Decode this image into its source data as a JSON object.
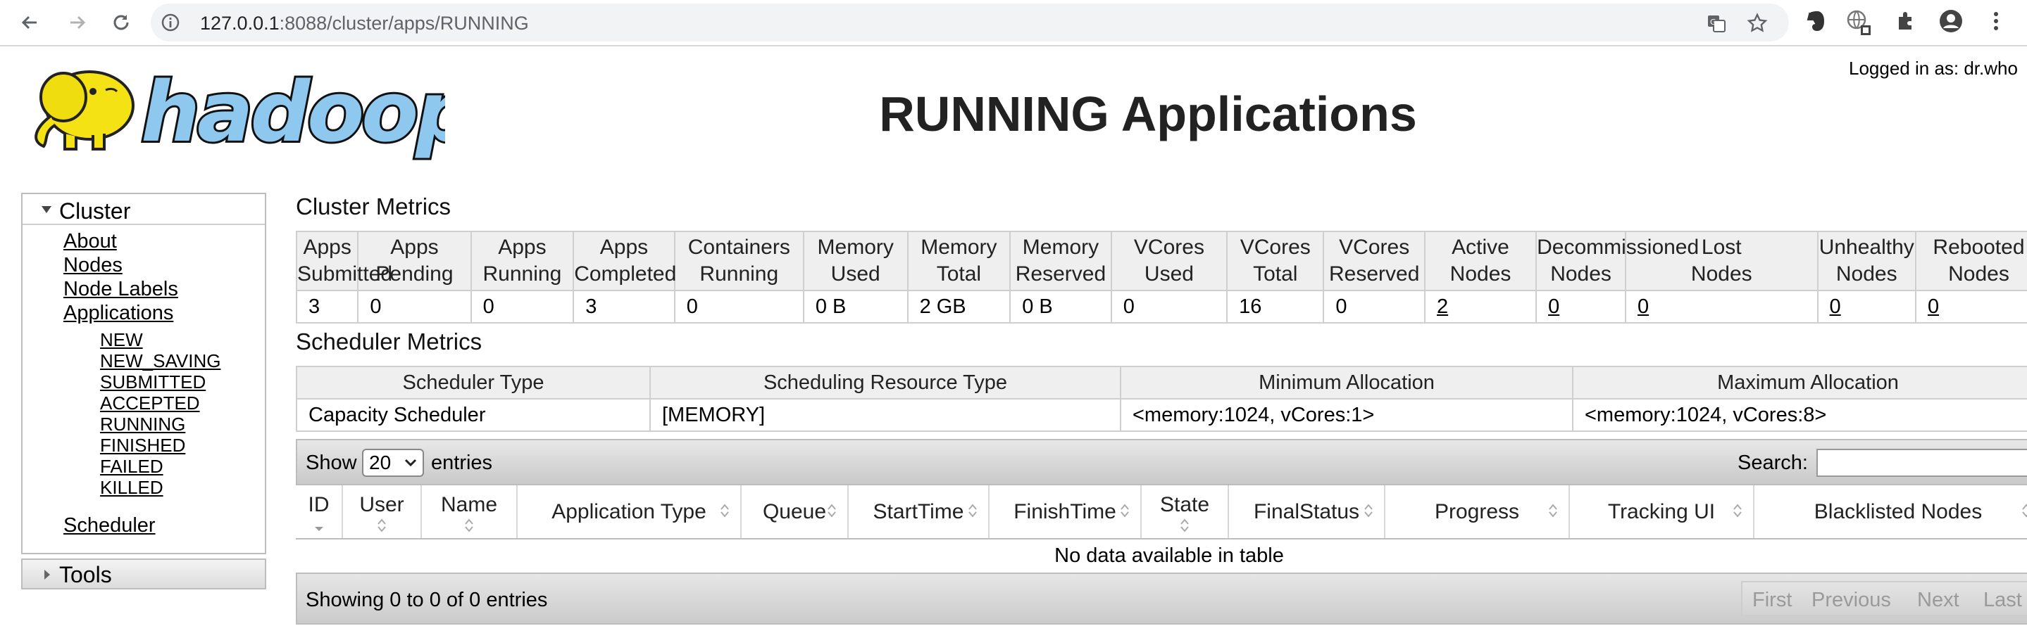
{
  "browser": {
    "url_host": "127.0.0.1",
    "url_path": ":8088/cluster/apps/RUNNING"
  },
  "header": {
    "logo_text": "hadoop",
    "title": "RUNNING Applications",
    "logged_in": "Logged in as: dr.who"
  },
  "sidebar": {
    "cluster_label": "Cluster",
    "links": [
      "About",
      "Nodes",
      "Node Labels",
      "Applications"
    ],
    "app_states": [
      "NEW",
      "NEW_SAVING",
      "SUBMITTED",
      "ACCEPTED",
      "RUNNING",
      "FINISHED",
      "FAILED",
      "KILLED"
    ],
    "scheduler_label": "Scheduler",
    "tools_label": "Tools"
  },
  "cluster_metrics": {
    "title": "Cluster Metrics",
    "headers": [
      [
        "Apps",
        "Submitted"
      ],
      [
        "Apps",
        "Pending"
      ],
      [
        "Apps",
        "Running"
      ],
      [
        "Apps",
        "Completed"
      ],
      [
        "Containers",
        "Running"
      ],
      [
        "Memory",
        "Used"
      ],
      [
        "Memory",
        "Total"
      ],
      [
        "Memory",
        "Reserved"
      ],
      [
        "VCores",
        "Used"
      ],
      [
        "VCores",
        "Total"
      ],
      [
        "VCores",
        "Reserved"
      ],
      [
        "Active",
        "Nodes"
      ],
      [
        "Decommissioned",
        "Nodes"
      ],
      [
        "Lost",
        "Nodes"
      ],
      [
        "Unhealthy",
        "Nodes"
      ],
      [
        "Rebooted",
        "Nodes"
      ]
    ],
    "values": [
      "3",
      "0",
      "0",
      "3",
      "0",
      "0 B",
      "2 GB",
      "0 B",
      "0",
      "16",
      "0",
      "2",
      "0",
      "0",
      "0",
      "0"
    ]
  },
  "scheduler_metrics": {
    "title": "Scheduler Metrics",
    "headers": [
      "Scheduler Type",
      "Scheduling Resource Type",
      "Minimum Allocation",
      "Maximum Allocation"
    ],
    "values": [
      "Capacity Scheduler",
      "[MEMORY]",
      "<memory:1024, vCores:1>",
      "<memory:1024, vCores:8>"
    ]
  },
  "apps_table": {
    "show_label": "Show",
    "page_size": "20",
    "entries_label": "entries",
    "search_label": "Search:",
    "search_value": "",
    "columns": [
      "ID",
      "User",
      "Name",
      "Application Type",
      "Queue",
      "StartTime",
      "FinishTime",
      "State",
      "FinalStatus",
      "Progress",
      "Tracking UI",
      "Blacklisted Nodes"
    ],
    "empty_message": "No data available in table",
    "info": "Showing 0 to 0 of 0 entries",
    "pager": [
      "First",
      "Previous",
      "Next",
      "Last"
    ]
  },
  "colors": {
    "header_bg": "#efefef",
    "border": "#cfcfcf",
    "toolbar_gradient_top": "#e8e8e8",
    "toolbar_gradient_bottom": "#c9c9c9",
    "disabled_text": "#9a9a9a"
  }
}
